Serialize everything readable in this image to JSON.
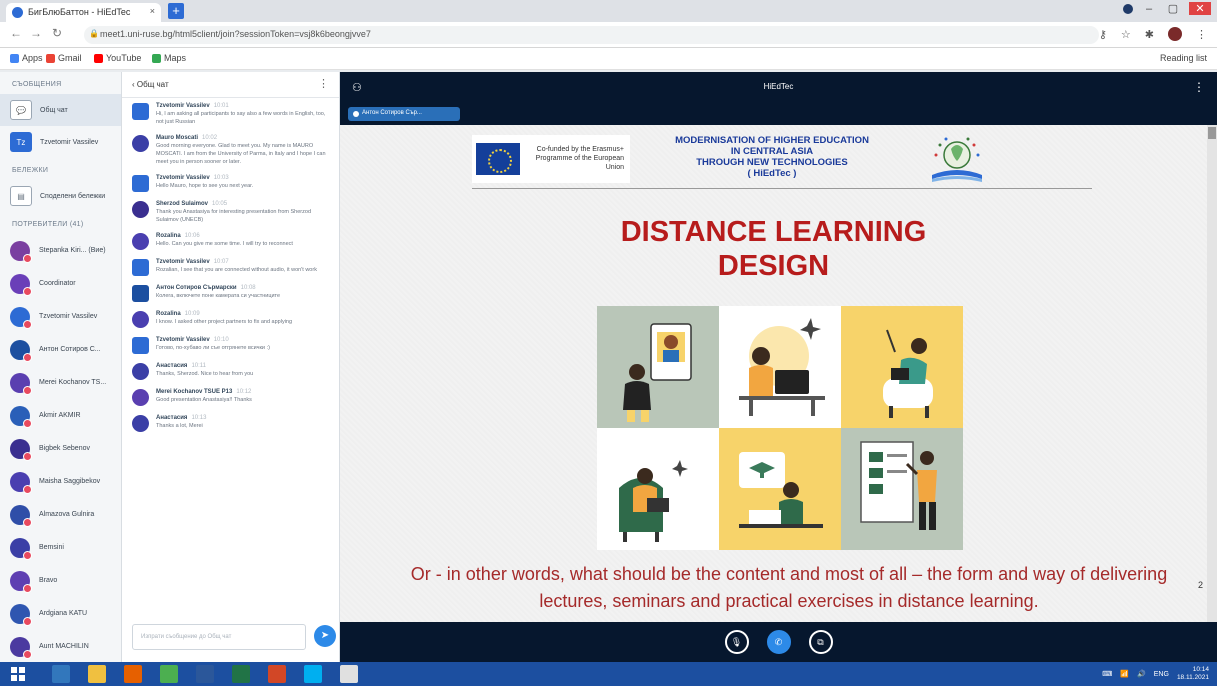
{
  "browser": {
    "tab_title": "БигБлюБаттон - HiEdTec",
    "tab_close": "×",
    "new_tab": "+",
    "address": "meet1.uni-ruse.bg/html5client/join?sessionToken=vsj8k6beongjvve7",
    "bookmarks": [
      {
        "label": "Apps",
        "color": "#4285f4"
      },
      {
        "label": "Gmail",
        "color": "#ea4335"
      },
      {
        "label": "YouTube",
        "color": "#ff0000"
      },
      {
        "label": "Maps",
        "color": "#34a853"
      }
    ],
    "reading_list": "Reading list"
  },
  "rail": {
    "messages_heading": "СЪОБЩЕНИЯ",
    "public_chat": "Общ чат",
    "private_chat": "Tzvetomir Vassilev",
    "notes_heading": "БЕЛЕЖКИ",
    "shared_notes": "Споделени бележки",
    "users_heading": "ПОТРЕБИТЕЛИ (41)",
    "users": [
      {
        "name": "Stepanka Kiri... (Вие)",
        "color": "#7a3fa0"
      },
      {
        "name": "Coordinator",
        "color": "#6a3fb8"
      },
      {
        "name": "Tzvetomir Vassilev",
        "color": "#2d6bd4"
      },
      {
        "name": "Aнтон Сотиров С...",
        "color": "#1c4fa0"
      },
      {
        "name": "Merei Kochanov TS...",
        "color": "#5a3fb0"
      },
      {
        "name": "Akmir AKMIR",
        "color": "#2a5fb8"
      },
      {
        "name": "Bigbek Sebenov",
        "color": "#3a2f90"
      },
      {
        "name": "Maisha Saggibekov",
        "color": "#4a3fb0"
      },
      {
        "name": "Almazova Gulnira",
        "color": "#2f4ea8"
      },
      {
        "name": "Bemsini",
        "color": "#3b3fa6"
      },
      {
        "name": "Bravo",
        "color": "#5e3fb2"
      },
      {
        "name": "Ardgiana KATU",
        "color": "#2f56b0"
      },
      {
        "name": "Aunt MACHILIN",
        "color": "#4b3aa0"
      }
    ]
  },
  "chat": {
    "title": "Общ чат",
    "messages": [
      {
        "initial": "Tz",
        "name": "Tzvetomir Vassilev",
        "time": "10:01",
        "text": "Hi, I am asking all participants to say also a few words in English, too, not just Russian",
        "color": "#2d6bd4",
        "square": true
      },
      {
        "initial": "Ma",
        "name": "Mauro Moscati",
        "time": "10:02",
        "text": "Good morning everyone. Glad to meet you. My name is MAURO MOSCATI. I am from the University of Parma, in Italy and I hope I can meet you in person sooner or later.",
        "color": "#3b3fa6",
        "square": false
      },
      {
        "initial": "Tz",
        "name": "Tzvetomir Vassilev",
        "time": "10:03",
        "text": "Hello Mauro, hope to see you next year.",
        "color": "#2d6bd4",
        "square": true
      },
      {
        "initial": "Sh",
        "name": "Sherzod Sulaimov",
        "time": "10:05",
        "text": "Thank you Anastasiya for interesting presentation from Sherzod Sulaimov (UNECB)",
        "color": "#3a2f90",
        "square": false
      },
      {
        "initial": "Ro",
        "name": "Rozalina",
        "time": "10:06",
        "text": "Hello. Can you give me some time. I will try to reconnect",
        "color": "#4a3fb0",
        "square": false
      },
      {
        "initial": "Tz",
        "name": "Tzvetomir Vassilev",
        "time": "10:07",
        "text": "Rozalian, I see that you are connected without audio, it won't work",
        "color": "#2d6bd4",
        "square": true
      },
      {
        "initial": "Ас",
        "name": "Антон Сотиров Сърмарски",
        "time": "10:08",
        "text": "Колега, включете поне камерата си участниците",
        "color": "#1c4fa0",
        "square": true
      },
      {
        "initial": "Ro",
        "name": "Rozalina",
        "time": "10:09",
        "text": "I know. I asked other project partners to fix and applying",
        "color": "#4a3fb0",
        "square": false
      },
      {
        "initial": "Tz",
        "name": "Tzvetomir Vassilev",
        "time": "10:10",
        "text": "Готово, по-хубаво ли съе отгрянете всички :)",
        "color": "#2d6bd4",
        "square": true
      },
      {
        "initial": "Ан",
        "name": "Анастасия",
        "time": "10:11",
        "text": "Thanks, Sherzod. Nice to hear from you",
        "color": "#3b3fa6",
        "square": false
      },
      {
        "initial": "Me",
        "name": "Merei Kochanov TSUE P13",
        "time": "10:12",
        "text": "Good presentation Anastasiya!! Thanks",
        "color": "#5a3fb0",
        "square": false
      },
      {
        "initial": "Ан",
        "name": "Анастасия",
        "time": "10:13",
        "text": "Thanks a lot, Merei",
        "color": "#3b3fa6",
        "square": false
      }
    ],
    "input_placeholder": "Изпрати съобщение до Общ чат",
    "send_icon": "➤"
  },
  "meeting": {
    "title": "HiEdTec",
    "presenter": "Антон Сотиров Сър...",
    "slide": {
      "eu_text": "Co-funded by the Erasmus+ Programme of the European Union",
      "project_title_lines": [
        "MODERNISATION OF HIGHER EDUCATION",
        "IN CENTRAL ASIA",
        "THROUGH NEW TECHNOLOGIES",
        "( HiEdTec )"
      ],
      "title_lines": [
        "DISTANCE LEARNING",
        "DESIGN"
      ],
      "caption": "Or - in other words, what should be the content and most of all – the form and way of delivering lectures, seminars and practical exercises in distance learning.",
      "page_number": "2",
      "illustration_colors": [
        "#b9c6b8",
        "#ffffff",
        "#f7d36a",
        "#ffffff",
        "#f7d36a",
        "#b9c6b8"
      ]
    },
    "controls": [
      "microphone-icon",
      "phone-icon",
      "screen-share-icon"
    ]
  },
  "taskbar": {
    "apps": [
      {
        "name": "edge-icon",
        "color": "#3277bc"
      },
      {
        "name": "folder-icon",
        "color": "#f0c040"
      },
      {
        "name": "firefox-icon",
        "color": "#e66000"
      },
      {
        "name": "chrome-icon",
        "color": "#4caf50"
      },
      {
        "name": "word-icon",
        "color": "#2b579a"
      },
      {
        "name": "excel-icon",
        "color": "#217346"
      },
      {
        "name": "powerpoint-icon",
        "color": "#d24726"
      },
      {
        "name": "skype-icon",
        "color": "#00aff0"
      },
      {
        "name": "paint-icon",
        "color": "#e0e0e0"
      }
    ],
    "lang": "ENG",
    "time": "10:14",
    "date": "18.11.2021"
  }
}
